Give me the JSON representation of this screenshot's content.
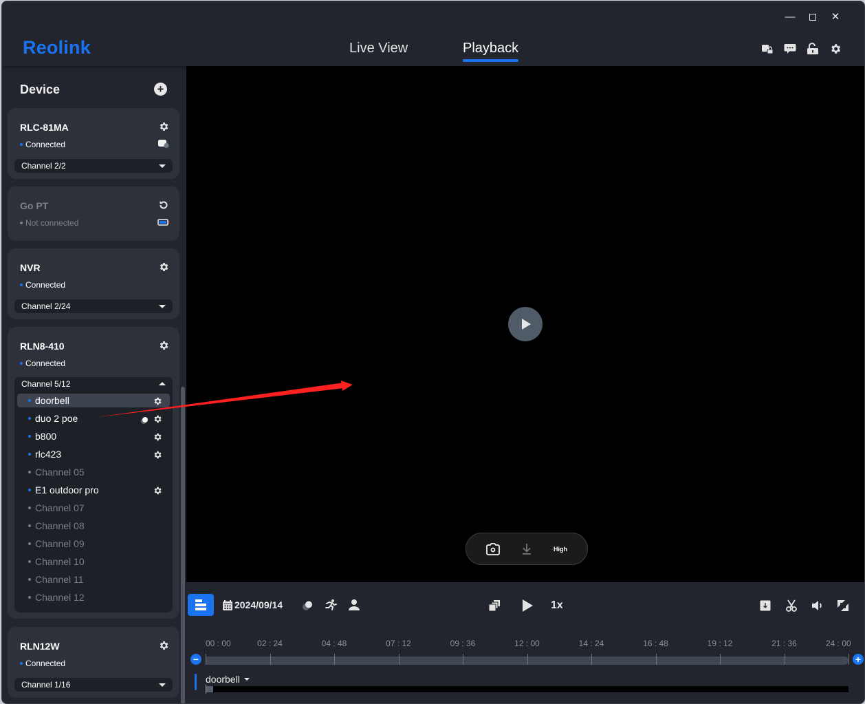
{
  "app": {
    "brand": "Reolink",
    "window_controls": {
      "minimize": "—",
      "maximize": "☐",
      "close": "✕"
    },
    "nav_tabs": [
      {
        "label": "Live View",
        "active": false
      },
      {
        "label": "Playback",
        "active": true
      }
    ],
    "header_icons": [
      "share-lock-icon",
      "message-icon",
      "unlock-icon",
      "settings-icon"
    ],
    "accent_color": "#1a74f2"
  },
  "sidebar": {
    "title": "Device",
    "add_label": "+",
    "devices": [
      {
        "name": "RLC-81MA",
        "status": "Connected",
        "connected": true,
        "channel": "Channel 2/2",
        "secondary_icon": "camera-sleep-icon"
      },
      {
        "name": "Go PT",
        "status": "Not connected",
        "connected": false,
        "channel": null,
        "secondary_icon": "battery-icon"
      },
      {
        "name": "NVR",
        "status": "Connected",
        "connected": true,
        "channel": "Channel 2/24"
      },
      {
        "name": "RLN8-410",
        "status": "Connected",
        "connected": true,
        "channel": "Channel 5/12",
        "expanded": true,
        "channels": [
          {
            "label": "doorbell",
            "online": true,
            "selected": true,
            "gear": true
          },
          {
            "label": "duo 2 poe",
            "online": true,
            "gear": true,
            "extra_icon": "sleep-icon"
          },
          {
            "label": "b800",
            "online": true,
            "gear": true
          },
          {
            "label": "rlc423",
            "online": true,
            "gear": true
          },
          {
            "label": "Channel 05",
            "online": false
          },
          {
            "label": "E1 outdoor pro",
            "online": true,
            "gear": true
          },
          {
            "label": "Channel 07",
            "online": false
          },
          {
            "label": "Channel 08",
            "online": false
          },
          {
            "label": "Channel 09",
            "online": false
          },
          {
            "label": "Channel 10",
            "online": false
          },
          {
            "label": "Channel 11",
            "online": false
          },
          {
            "label": "Channel 12",
            "online": false
          }
        ]
      },
      {
        "name": "RLN12W",
        "status": "Connected",
        "connected": true,
        "channel": "Channel 1/16"
      }
    ]
  },
  "player": {
    "overlay": {
      "snapshot": "camera-icon",
      "download": "download-icon",
      "quality": "High"
    }
  },
  "controls": {
    "date": "2024/09/14",
    "speed": "1x",
    "left_icons": [
      "list-view-icon",
      "calendar-icon",
      "sleep-filter-icon",
      "motion-person-icon",
      "person-icon"
    ],
    "center_icons": [
      "multi-window-icon",
      "play-icon"
    ],
    "right_icons": [
      "download-box-icon",
      "scissors-icon",
      "volume-icon",
      "fullscreen-icon"
    ]
  },
  "timeline": {
    "ticks": [
      "00 : 00",
      "02 : 24",
      "04 : 48",
      "07 : 12",
      "09 : 36",
      "12 : 00",
      "14 : 24",
      "16 : 48",
      "19 : 12",
      "21 : 36",
      "24 : 00"
    ],
    "zoom_out": "−",
    "zoom_in": "+",
    "tracks": [
      {
        "name": "doorbell",
        "recording_start_fraction": 0.0,
        "recording_end_fraction": 0.012
      }
    ]
  },
  "annotation": {
    "type": "arrow",
    "color": "#ff2020"
  }
}
